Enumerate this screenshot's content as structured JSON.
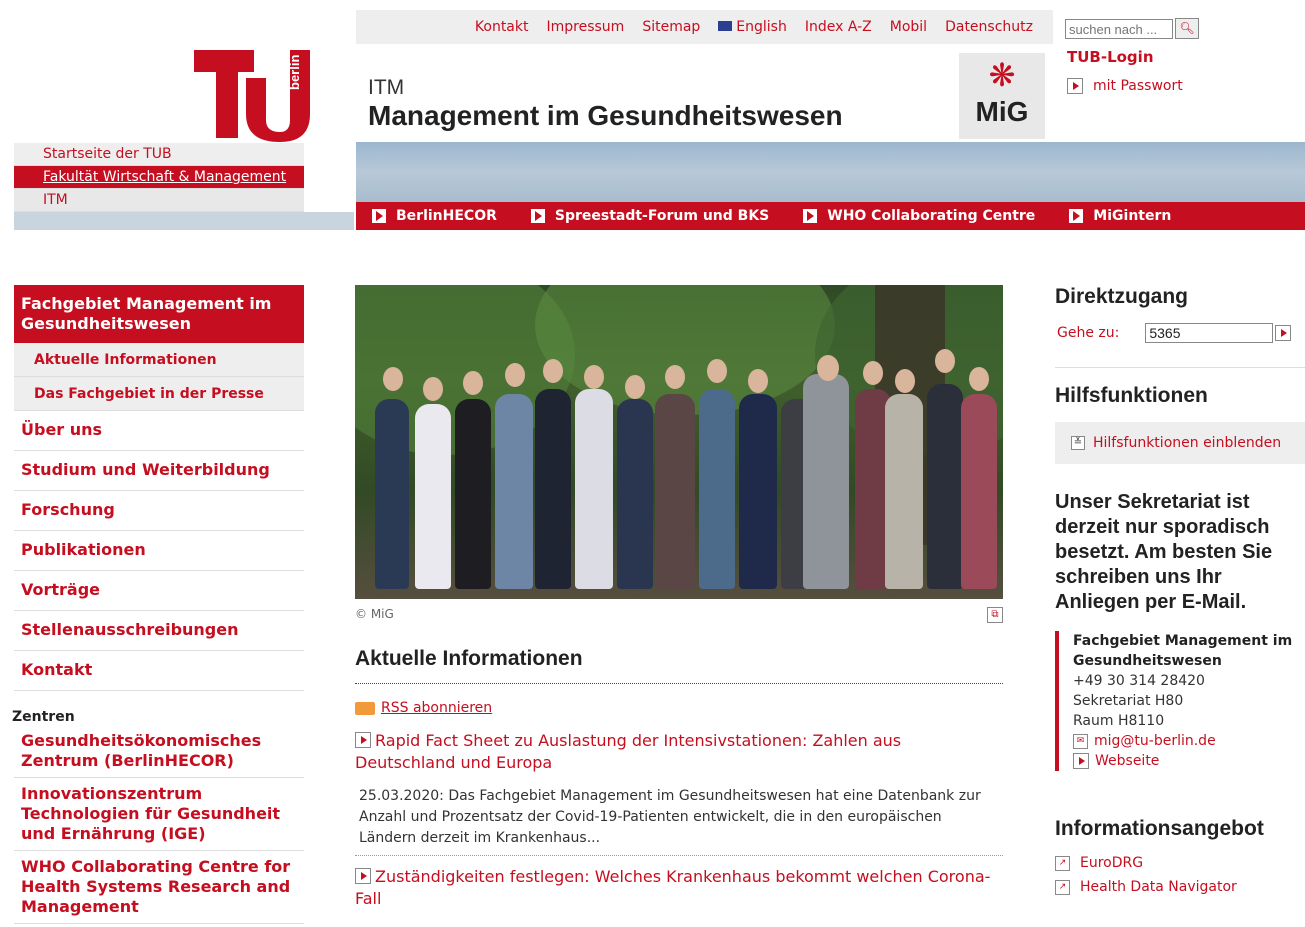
{
  "meta_nav": [
    "Kontakt",
    "Impressum",
    "Sitemap",
    "English",
    "Index A-Z",
    "Mobil",
    "Datenschutz"
  ],
  "search": {
    "placeholder": "suchen nach ..."
  },
  "login": {
    "title": "TUB-Login",
    "password_link": "mit Passwort"
  },
  "breadcrumbs": [
    "Startseite der TUB",
    "Fakultät Wirtschaft & Management",
    "ITM"
  ],
  "header": {
    "institute": "ITM",
    "title": "Management im Gesundheitswesen",
    "logo_text": "MiG"
  },
  "top_tabs": [
    "BerlinHECOR",
    "Spreestadt-Forum und BKS",
    "WHO Collaborating Centre",
    "MiGintern"
  ],
  "leftnav": {
    "current": "Fachgebiet Management im Gesundheitswesen",
    "sub_items": [
      "Aktuelle Informationen",
      "Das Fachgebiet in der Presse"
    ],
    "items": [
      "Über uns",
      "Studium und Weiterbildung",
      "Forschung",
      "Publikationen",
      "Vorträge",
      "Stellenausschreibungen",
      "Kontakt"
    ],
    "section_label": "Zentren",
    "centers": [
      "Gesundheitsökonomisches Zentrum (BerlinHECOR)",
      "Innovationszentrum Technologien für Gesundheit und Ernährung (IGE)",
      "WHO Collaborating Centre for Health Systems Research and Management"
    ]
  },
  "main": {
    "photo_caption": "© MiG",
    "section_title": "Aktuelle Informationen",
    "rss_label": "RSS abonnieren",
    "news": [
      {
        "title": "Rapid Fact Sheet zu Auslastung der Intensivstationen: Zahlen aus Deutschland und Europa",
        "text": "25.03.2020: Das Fachgebiet Management im Gesundheitswesen hat eine Datenbank zur Anzahl und Prozentsatz der Covid-19-Patienten entwickelt, die in den europäischen Ländern derzeit im Krankenhaus..."
      },
      {
        "title": "Zuständigkeiten festlegen: Welches Krankenhaus bekommt welchen Corona-Fall",
        "text": ""
      }
    ]
  },
  "right": {
    "direct_title": "Direktzugang",
    "goto_label": "Gehe zu:",
    "goto_value": "5365",
    "help_title": "Hilfsfunktionen",
    "help_toggle": "Hilfsfunktionen einblenden",
    "notice": "Unser Sekretariat ist derzeit nur sporadisch besetzt. Am besten Sie schreiben uns Ihr Anliegen per E-Mail.",
    "contact": {
      "org": "Fachgebiet Management im Gesundheitswesen",
      "phone": "+49 30 314 28420",
      "office": "Sekretariat H80",
      "room": "Raum H8110",
      "email": "mig@tu-berlin.de",
      "web": "Webseite"
    },
    "info_title": "Informationsangebot",
    "info_links": [
      "EuroDRG",
      "Health Data Navigator"
    ]
  },
  "colors": {
    "accent": "#c50e1f",
    "sky": "#a9bccd",
    "panel": "#eeeeee"
  }
}
